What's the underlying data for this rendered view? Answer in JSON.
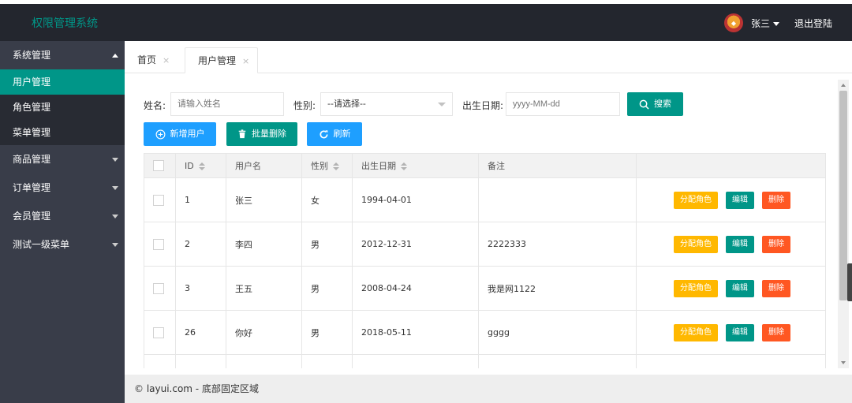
{
  "header": {
    "logo": "权限管理系统",
    "avatar_text": "*",
    "username": "张三",
    "logout": "退出登陆"
  },
  "sidebar": {
    "groups": [
      {
        "label": "系统管理",
        "expanded": true,
        "items": [
          "用户管理",
          "角色管理",
          "菜单管理"
        ],
        "active": "用户管理"
      },
      {
        "label": "商品管理",
        "expanded": false
      },
      {
        "label": "订单管理",
        "expanded": false
      },
      {
        "label": "会员管理",
        "expanded": false
      },
      {
        "label": "测试一级菜单",
        "expanded": false
      }
    ]
  },
  "tabs": [
    {
      "label": "首页",
      "close": "×"
    },
    {
      "label": "用户管理",
      "close": "×",
      "active": true
    }
  ],
  "search": {
    "name_label": "姓名:",
    "name_placeholder": "请输入姓名",
    "gender_label": "性别:",
    "gender_value": "--请选择--",
    "birth_label": "出生日期:",
    "birth_placeholder": "yyyy-MM-dd",
    "search_button": "搜索"
  },
  "toolbar": {
    "add_user": "新增用户",
    "batch_delete": "批量删除",
    "refresh": "刷新"
  },
  "table": {
    "columns": [
      "ID",
      "用户名",
      "性别",
      "出生日期",
      "备注"
    ],
    "rows": [
      {
        "id": "1",
        "name": "张三",
        "gender": "女",
        "birth": "1994-04-01",
        "remark": ""
      },
      {
        "id": "2",
        "name": "李四",
        "gender": "男",
        "birth": "2012-12-31",
        "remark": "2222333"
      },
      {
        "id": "3",
        "name": "王五",
        "gender": "男",
        "birth": "2008-04-24",
        "remark": "我是网1122"
      },
      {
        "id": "26",
        "name": "你好",
        "gender": "男",
        "birth": "2018-05-11",
        "remark": "gggg"
      }
    ],
    "actions": {
      "assign_role": "分配角色",
      "edit": "编辑",
      "delete": "删除"
    }
  },
  "footer": "© layui.com - 底部固定区域",
  "colors": {
    "header_bg": "#23262e",
    "sidebar_bg": "#393d49",
    "accent_green": "#009688",
    "accent_blue": "#1e9fff",
    "warn_yellow": "#ffb800",
    "danger_orange": "#ff5722"
  }
}
